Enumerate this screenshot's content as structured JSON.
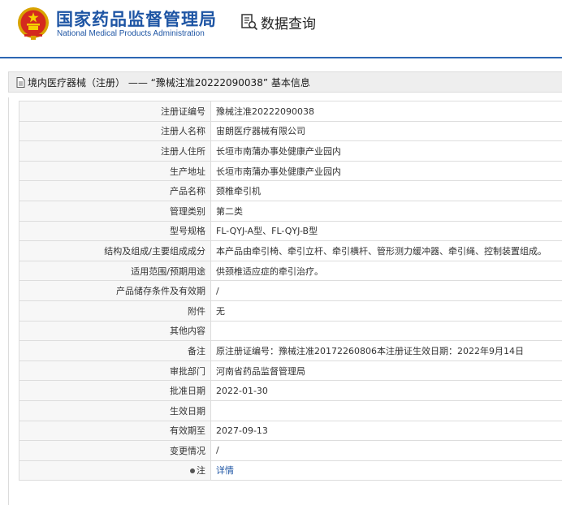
{
  "header": {
    "org_cn": "国家药品监督管理局",
    "org_en": "National Medical Products Administration",
    "query_label": "数据查询",
    "brand_color": "#1e55a4",
    "emblem_icon": "national-emblem-icon",
    "query_icon": "search-document-icon"
  },
  "titlebar": {
    "text": "境内医疗器械（注册） —— “豫械注准20222090038” 基本信息"
  },
  "rows": [
    {
      "label": "注册证编号",
      "value": "豫械注准20222090038"
    },
    {
      "label": "注册人名称",
      "value": "宙朗医疗器械有限公司"
    },
    {
      "label": "注册人住所",
      "value": "长垣市南蒲办事处健康产业园内"
    },
    {
      "label": "生产地址",
      "value": "长垣市南蒲办事处健康产业园内"
    },
    {
      "label": "产品名称",
      "value": "颈椎牵引机"
    },
    {
      "label": "管理类别",
      "value": "第二类"
    },
    {
      "label": "型号规格",
      "value": "FL-QYJ-A型、FL-QYJ-B型"
    },
    {
      "label": "结构及组成/主要组成成分",
      "value": "本产品由牵引椅、牵引立杆、牵引横杆、管形测力缓冲器、牵引绳、控制装置组成。"
    },
    {
      "label": "适用范围/预期用途",
      "value": "供颈椎适应症的牵引治疗。"
    },
    {
      "label": "产品储存条件及有效期",
      "value": "/"
    },
    {
      "label": "附件",
      "value": "无"
    },
    {
      "label": "其他内容",
      "value": ""
    },
    {
      "label": "备注",
      "value": "原注册证编号：豫械注准20172260806本注册证生效日期：2022年9月14日"
    },
    {
      "label": "审批部门",
      "value": "河南省药品监督管理局"
    },
    {
      "label": "批准日期",
      "value": "2022-01-30"
    },
    {
      "label": "生效日期",
      "value": ""
    },
    {
      "label": "有效期至",
      "value": "2027-09-13"
    },
    {
      "label": "变更情况",
      "value": "/"
    }
  ],
  "note_row": {
    "label": "注",
    "link_text": "详情"
  }
}
